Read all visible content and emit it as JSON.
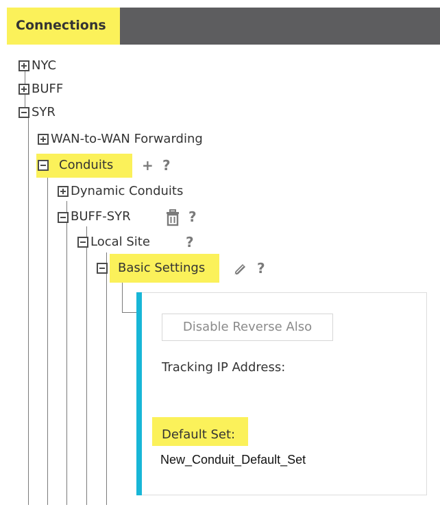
{
  "header": {
    "title": "Connections"
  },
  "tree": {
    "nyc": "NYC",
    "buff": "BUFF",
    "syr": "SYR",
    "wan_forwarding": "WAN-to-WAN Forwarding",
    "conduits": "Conduits",
    "dynamic_conduits": "Dynamic Conduits",
    "buff_syr": "BUFF-SYR",
    "local_site": "Local Site",
    "basic_settings": "Basic Settings"
  },
  "actions": {
    "add": "+",
    "help": "?"
  },
  "panel": {
    "disable_reverse_label": "Disable Reverse Also",
    "tracking_ip_label": "Tracking IP Address:",
    "default_set_label": "Default Set:",
    "default_set_value": "New_Conduit_Default_Set"
  },
  "colors": {
    "header_bg": "#5d5d5f",
    "highlight": "#fbf15a",
    "panel_accent": "#18b6d7"
  },
  "icons": [
    "expand-icon",
    "collapse-icon",
    "plus-icon",
    "help-icon",
    "trash-icon",
    "pencil-icon"
  ]
}
